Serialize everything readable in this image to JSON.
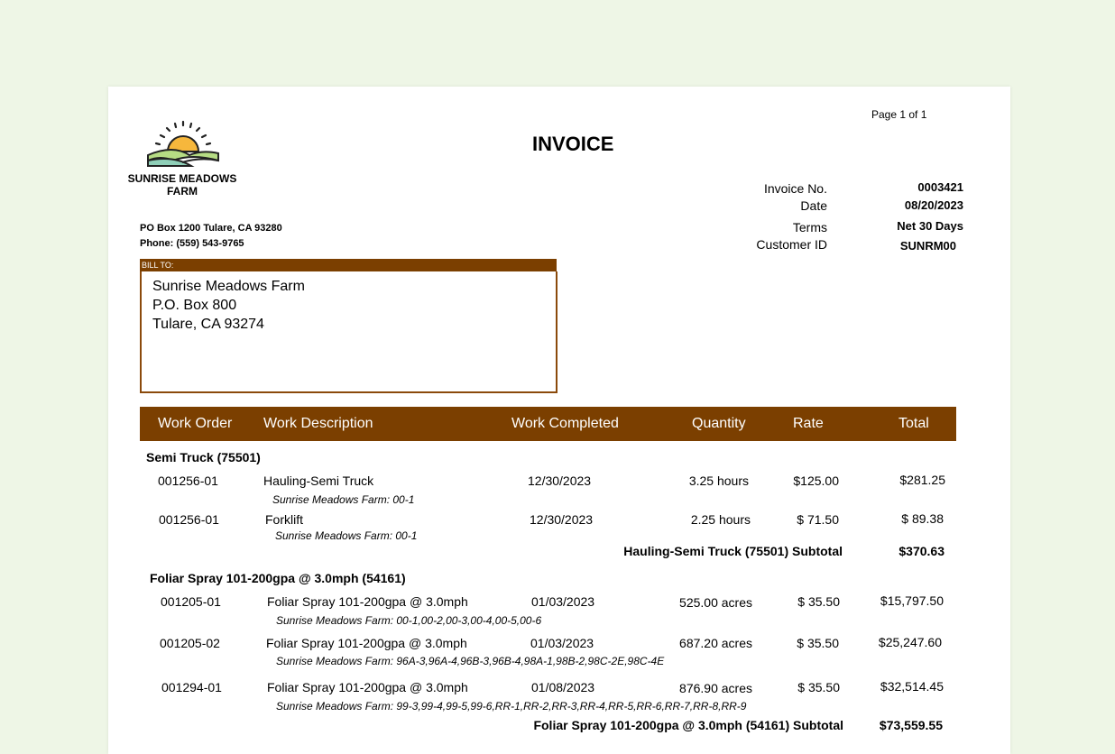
{
  "page_number": "Page 1 of 1",
  "title": "INVOICE",
  "company": {
    "name_line1": "SUNRISE MEADOWS",
    "name_line2": "FARM",
    "address": "PO Box 1200 Tulare, CA  93280",
    "phone": "Phone:  (559) 543-9765"
  },
  "meta": {
    "invoice_no_label": "Invoice No.",
    "invoice_no": "0003421",
    "date_label": "Date",
    "date": "08/20/2023",
    "terms_label": "Terms",
    "terms": "Net 30 Days",
    "customer_id_label": "Customer ID",
    "customer_id": "SUNRM00"
  },
  "bill_to": {
    "label": "BILL TO:",
    "line1": "Sunrise Meadows Farm",
    "line2": "P.O. Box  800",
    "line3": "Tulare, CA  93274"
  },
  "columns": [
    "Work Order",
    "Work Description",
    "Work Completed",
    "Quantity",
    "Rate",
    "Total"
  ],
  "groups": [
    {
      "name": "Semi Truck (75501)",
      "rows": [
        {
          "work_order": "001256-01",
          "description": "Hauling-Semi Truck",
          "completed": "12/30/2023",
          "quantity": "3.25 hours",
          "rate": "$125.00",
          "total": "$281.25",
          "detail": "Sunrise Meadows Farm: 00-1"
        },
        {
          "work_order": "001256-01",
          "description": "Forklift",
          "completed": "12/30/2023",
          "quantity": "2.25 hours",
          "rate": "$ 71.50",
          "total": "$ 89.38",
          "detail": "Sunrise Meadows Farm: 00-1"
        }
      ],
      "subtotal_label": "Hauling-Semi Truck (75501) Subtotal",
      "subtotal": "$370.63"
    },
    {
      "name": "Foliar Spray 101-200gpa @ 3.0mph (54161)",
      "rows": [
        {
          "work_order": "001205-01",
          "description": "Foliar Spray 101-200gpa @ 3.0mph",
          "completed": "01/03/2023",
          "quantity": "525.00 acres",
          "rate": "$ 35.50",
          "total": "$15,797.50",
          "detail": "Sunrise Meadows Farm: 00-1,00-2,00-3,00-4,00-5,00-6"
        },
        {
          "work_order": "001205-02",
          "description": "Foliar Spray 101-200gpa @ 3.0mph",
          "completed": "01/03/2023",
          "quantity": "687.20 acres",
          "rate": "$ 35.50",
          "total": "$25,247.60",
          "detail": "Sunrise Meadows Farm: 96A-3,96A-4,96B-3,96B-4,98A-1,98B-2,98C-2E,98C-4E"
        },
        {
          "work_order": "001294-01",
          "description": "Foliar Spray 101-200gpa @ 3.0mph",
          "completed": "01/08/2023",
          "quantity": "876.90 acres",
          "rate": "$ 35.50",
          "total": "$32,514.45",
          "detail": "Sunrise Meadows Farm: 99-3,99-4,99-5,99-6,RR-1,RR-2,RR-3,RR-4,RR-5,RR-6,RR-7,RR-8,RR-9"
        }
      ],
      "subtotal_label": "Foliar Spray 101-200gpa @ 3.0mph (54161) Subtotal",
      "subtotal": "$73,559.55"
    }
  ],
  "colors": {
    "accent": "#7b3f00",
    "page_bg": "#eef6e6",
    "sun": "#f6b73c",
    "hill_green": "#b6dc84",
    "hill_teal": "#8fcfb8"
  },
  "logo_icon": "sunrise-hills-icon"
}
